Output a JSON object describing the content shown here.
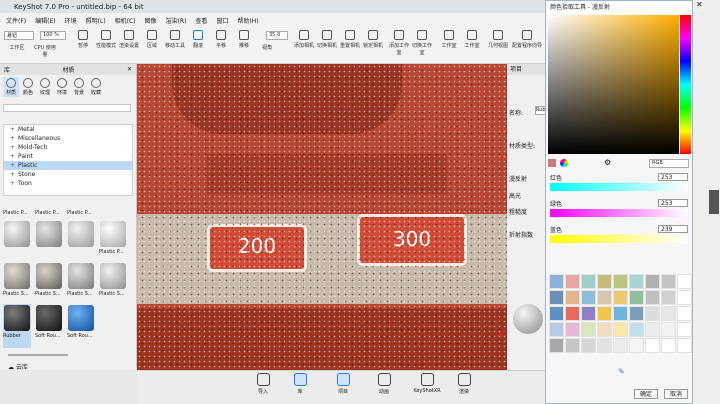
{
  "app": {
    "title": "KeyShot 7.0 Pro  -  untitled.bip  -  64 bit"
  },
  "menu": [
    "文件(F)",
    "编辑(E)",
    "环境",
    "照明(L)",
    "相机(C)",
    "图像",
    "渲染(R)",
    "查看",
    "窗口",
    "帮助(H)"
  ],
  "toolbar": {
    "workspace_select": "悬钮",
    "zoom_select": "100 %",
    "fov_value": "35.0",
    "items": [
      "工作区",
      "CPU 使用量",
      "暂停",
      "性能模式",
      "渲染设置",
      "区域",
      "移动工具",
      "翻滚",
      "平移",
      "推移",
      "视角",
      "添加相机",
      "切换相机",
      "重置相机",
      "锁定相机",
      "添加工作室",
      "切换工作室",
      "工作室",
      "工作室",
      "几何视图",
      "配置程序向导"
    ]
  },
  "library": {
    "header_left": "库",
    "header_right": "材质",
    "tabs": [
      "材质",
      "颜色",
      "纹理",
      "环境",
      "背景",
      "收藏"
    ],
    "tree": [
      "Metal",
      "Miscellaneous",
      "Mold-Tech",
      "Paint",
      "Plastic",
      "Stone",
      "Toon"
    ],
    "selected_tree": "Plastic",
    "thumbs": [
      "Plastic P...",
      "Plastic P...",
      "Plastic P...",
      "Plastic P...",
      "Plastic S...",
      "Plastic S...",
      "Plastic S...",
      "Plastic S...",
      "Rubber",
      "Soft Rou...",
      "Soft Rou..."
    ],
    "selected_thumb": "Rubber"
  },
  "viewport": {
    "badges": [
      "200",
      "300"
    ]
  },
  "project": {
    "header": "项目",
    "name_label": "名称:",
    "name_value": "Rub",
    "material_type": "材质类型:",
    "diffuse": "漫反射",
    "specular": "高光",
    "roughness": "粗糙度",
    "refraction": "折射指数"
  },
  "bottom": [
    "导入",
    "库",
    "项目",
    "动画",
    "KeyShotXR",
    "渲染"
  ],
  "bottom_left": "云库",
  "picker": {
    "title": "颜色拾取工具 - 漫反射",
    "mode": "RGB",
    "red_label": "红色",
    "red_value": "253",
    "green_label": "绿色",
    "green_value": "253",
    "blue_label": "蓝色",
    "blue_value": "239",
    "ok": "确定",
    "cancel": "取消"
  },
  "swatch_colors": [
    "#8cb2dc",
    "#e8a6a0",
    "#9fd0c8",
    "#c6bb7a",
    "#b9c483",
    "#a7d5d0",
    "#b0b0b0",
    "#c4c4c4",
    "#ffffff",
    "#6a8fb6",
    "#e4b58b",
    "#8bbfd4",
    "#d8c5b0",
    "#ecc871",
    "#8fc09d",
    "#c0c0c0",
    "#d0d0d0",
    "#ffffff",
    "#5f90c4",
    "#e86a5a",
    "#8e80c8",
    "#f1c548",
    "#6fb4df",
    "#7d9fbb",
    "#dcdcdc",
    "#e6e6e6",
    "#ffffff",
    "#b8c9e9",
    "#e9b7d6",
    "#dae7bd",
    "#f2dcc0",
    "#f6e8a8",
    "#bfe0ea",
    "#ececec",
    "#f2f2f2",
    "#ffffff",
    "#a8a8a8",
    "#c6c6c6",
    "#d6d6d6",
    "#e2e2e2",
    "#ededed",
    "#f5f5f5",
    "#ffffff",
    "#ffffff",
    "#ffffff"
  ],
  "colors": {
    "accent": "#1e7bd8",
    "viewport": "#b74733",
    "selection": "#bcd8f5"
  }
}
